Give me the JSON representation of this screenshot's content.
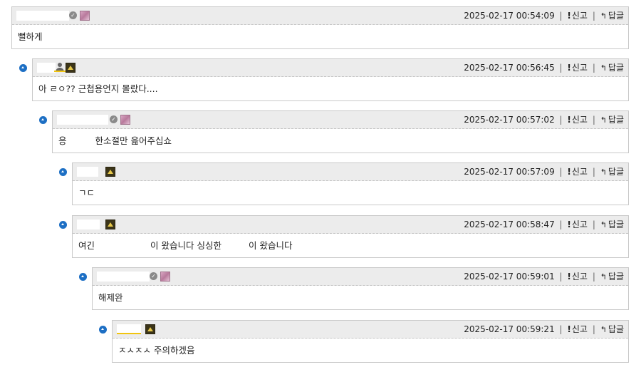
{
  "actions": {
    "report_label": "신고",
    "reply_label": "답글",
    "report_mark": "!",
    "reply_mark": "↰",
    "separator": "|"
  },
  "comments": [
    {
      "timestamp": "2025-02-17 00:54:09",
      "body": "뻘하게"
    },
    {
      "timestamp": "2025-02-17 00:56:45",
      "body": "아 ㄹㅇ?? 근첩용언지 몰랐다...."
    },
    {
      "timestamp": "2025-02-17 00:57:02",
      "body_a": "응",
      "body_b": "한소절만 읊어주십쇼"
    },
    {
      "timestamp": "2025-02-17 00:57:09",
      "body": "ㄱㄷ"
    },
    {
      "timestamp": "2025-02-17 00:58:47",
      "body_a": "여긴",
      "body_b": "이 왔습니다 싱싱한",
      "body_c": "이 왔습니다"
    },
    {
      "timestamp": "2025-02-17 00:59:01",
      "body": "해제완"
    },
    {
      "timestamp": "2025-02-17 00:59:21",
      "body": "ㅈㅅㅈㅅ 주의하겠음"
    }
  ],
  "icons": {
    "verified": "check-badge-icon",
    "member": "user-icon",
    "collapse": "collapse-up-icon",
    "avatar_pink": "pink-avatar-icon",
    "avatar_gold": "gold-avatar-icon"
  }
}
